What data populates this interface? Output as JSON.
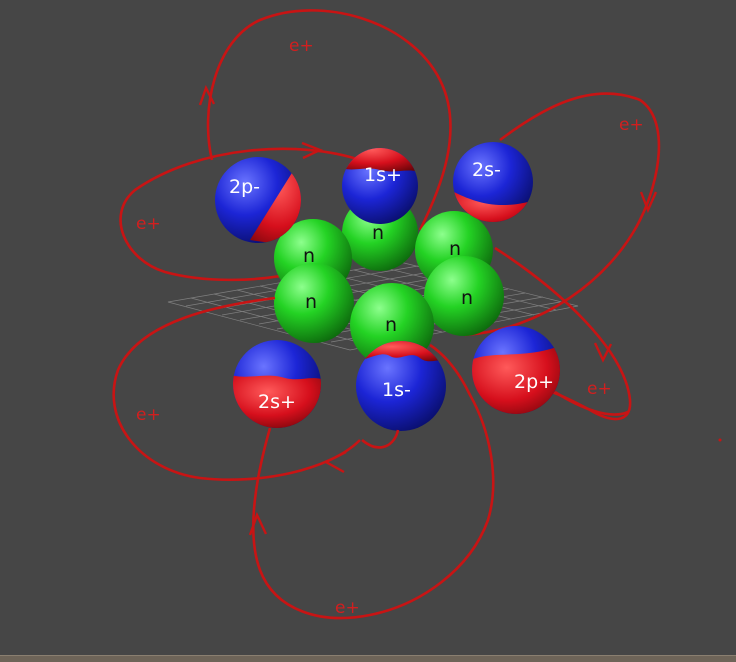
{
  "scene": {
    "background": "#464646",
    "colors": {
      "orbit": "#c81414",
      "positron_label": "#d21f1f",
      "neutron": "#2fd62f",
      "electron_blue": "#1a24d8",
      "electron_red": "#e01020"
    }
  },
  "labels": {
    "orbit_2p_minus": "e+",
    "orbit_top_left": "e+",
    "orbit_2s_minus": "e+",
    "orbit_2p_plus": "e+",
    "orbit_2s_plus": "e+",
    "orbit_1s_minus": "e+",
    "electron_2p_minus": "2p-",
    "electron_1s_plus": "1s+",
    "electron_2s_minus": "2s-",
    "electron_2s_plus": "2s+",
    "electron_1s_minus": "1s-",
    "electron_2p_plus": "2p+",
    "neutron": "n"
  }
}
